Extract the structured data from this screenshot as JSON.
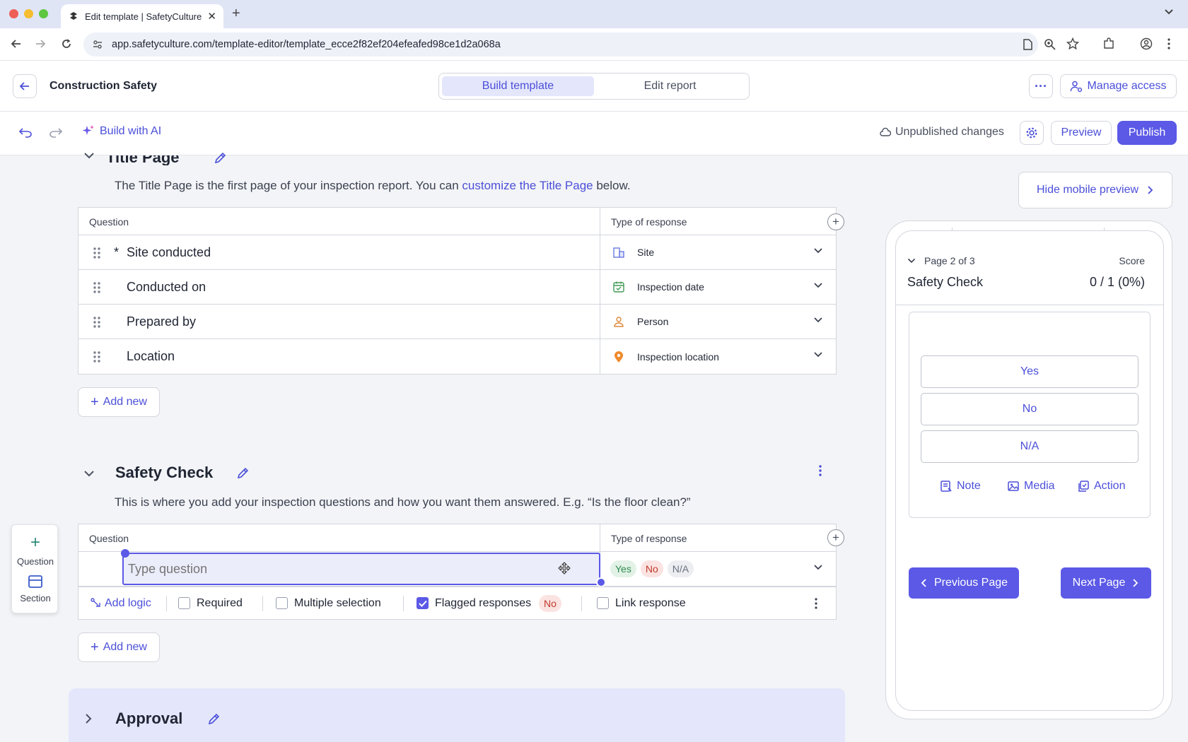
{
  "browser": {
    "tab_title": "Edit template | SafetyCulture",
    "url": "app.safetyculture.com/template-editor/template_ecce2f82ef204efeafed98ce1d2a068a"
  },
  "header": {
    "title": "Construction Safety",
    "tabs": [
      {
        "label": "Build template",
        "active": true
      },
      {
        "label": "Edit report",
        "active": false
      }
    ],
    "manage_access": "Manage access",
    "more": "···"
  },
  "toolbar": {
    "build_ai": "Build with AI",
    "status": "Unpublished changes",
    "preview": "Preview",
    "publish": "Publish"
  },
  "title_page": {
    "title": "Title Page",
    "desc_before": "The Title Page is the first page of your inspection report. You can ",
    "desc_link": "customize the Title Page",
    "desc_after": " below.",
    "col_question": "Question",
    "col_response": "Type of response",
    "rows": [
      {
        "question": "Site conducted",
        "required": "*",
        "response": "Site",
        "icon": "building-icon"
      },
      {
        "question": "Conducted on",
        "required": "",
        "response": "Inspection date",
        "icon": "calendar-check-icon"
      },
      {
        "question": "Prepared by",
        "required": "",
        "response": "Person",
        "icon": "person-icon"
      },
      {
        "question": "Location",
        "required": "",
        "response": "Inspection location",
        "icon": "location-pin-icon"
      }
    ],
    "add_new": "Add new"
  },
  "safety_check": {
    "title": "Safety Check",
    "desc": "This is where you add your inspection questions and how you want them answered. E.g. “Is the floor clean?”",
    "col_question": "Question",
    "col_response": "Type of response",
    "question_placeholder": "Type question",
    "responses": [
      "Yes",
      "No",
      "N/A"
    ],
    "options": {
      "add_logic": "Add logic",
      "required": "Required",
      "required_checked": false,
      "multiple": "Multiple selection",
      "multiple_checked": false,
      "flagged": "Flagged responses",
      "flagged_checked": true,
      "flagged_value": "No",
      "link": "Link response",
      "link_checked": false
    },
    "add_new": "Add new"
  },
  "approval": {
    "title": "Approval"
  },
  "add_panel": {
    "question": "Question",
    "section": "Section"
  },
  "mobile_preview": {
    "hide_button": "Hide mobile preview",
    "page_indicator": "Page 2 of 3",
    "score_label": "Score",
    "section_title": "Safety Check",
    "score_value": "0 / 1 (0%)",
    "answers": [
      "Yes",
      "No",
      "N/A"
    ],
    "actions": [
      "Note",
      "Media",
      "Action"
    ],
    "prev_page": "Previous Page",
    "next_page": "Next Page"
  },
  "colors": {
    "accent": "#5b59e6",
    "accent_text": "#4b4fd8",
    "selected_tab_bg": "#e4e6fb",
    "yes_green": "#2e8b4e",
    "no_red": "#c0392b"
  }
}
